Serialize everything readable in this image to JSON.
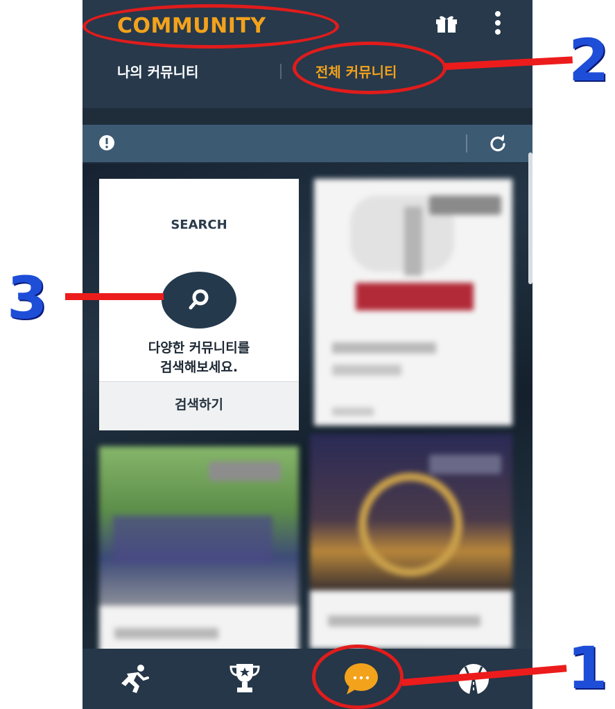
{
  "header": {
    "title": "COMMUNITY",
    "tabs": [
      {
        "label": "나의 커뮤니티",
        "active": false
      },
      {
        "label": "전체 커뮤니티",
        "active": true
      }
    ]
  },
  "search_card": {
    "heading": "SEARCH",
    "description_lines": [
      "다양한 커뮤니티를",
      "검색해보세요."
    ],
    "action_label": "검색하기"
  },
  "bottom_nav": {
    "items": [
      "run-icon",
      "trophy-icon",
      "chat-icon",
      "map-icon"
    ],
    "selected": "chat-icon"
  },
  "annotations": [
    "1",
    "2",
    "3"
  ],
  "colors": {
    "accent": "#f3a21c",
    "header_bg": "#27394b",
    "notice_bar": "#3d5a73",
    "annotation_red": "#e01c1c",
    "annotation_blue": "#1e4ed8"
  }
}
